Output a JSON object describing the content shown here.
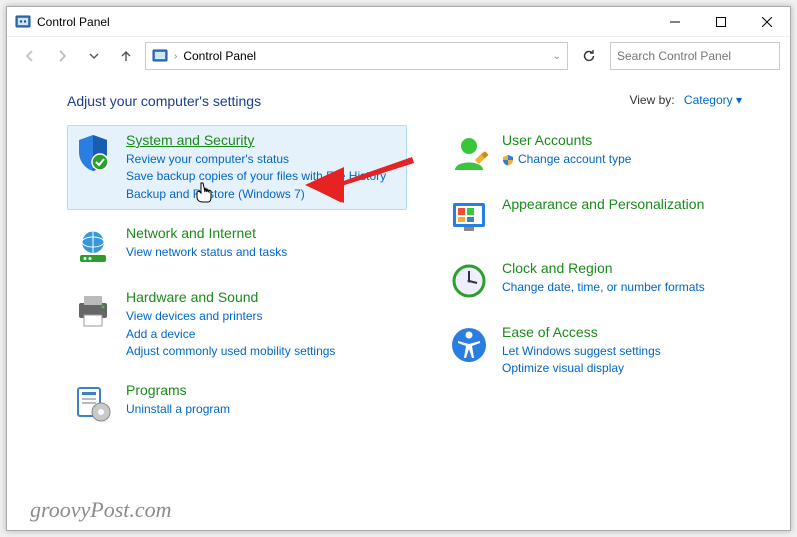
{
  "window": {
    "title": "Control Panel"
  },
  "address": {
    "text": "Control Panel"
  },
  "search": {
    "placeholder": "Search Control Panel"
  },
  "main": {
    "heading": "Adjust your computer's settings",
    "viewby_label": "View by:",
    "viewby_value": "Category"
  },
  "left": [
    {
      "title": "System and Security",
      "links": [
        "Review your computer's status",
        "Save backup copies of your files with File History",
        "Backup and Restore (Windows 7)"
      ]
    },
    {
      "title": "Network and Internet",
      "links": [
        "View network status and tasks"
      ]
    },
    {
      "title": "Hardware and Sound",
      "links": [
        "View devices and printers",
        "Add a device",
        "Adjust commonly used mobility settings"
      ]
    },
    {
      "title": "Programs",
      "links": [
        "Uninstall a program"
      ]
    }
  ],
  "right": [
    {
      "title": "User Accounts",
      "links": [
        "Change account type"
      ]
    },
    {
      "title": "Appearance and Personalization",
      "links": []
    },
    {
      "title": "Clock and Region",
      "links": [
        "Change date, time, or number formats"
      ]
    },
    {
      "title": "Ease of Access",
      "links": [
        "Let Windows suggest settings",
        "Optimize visual display"
      ]
    }
  ],
  "watermark": "groovyPost.com"
}
